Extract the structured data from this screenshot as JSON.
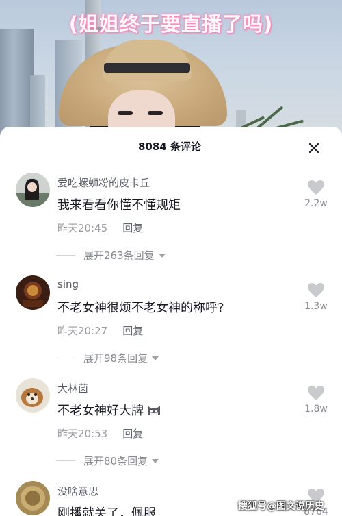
{
  "video": {
    "subtitle": "(姐姐终于要直播了吗)"
  },
  "sheet": {
    "title": "8084 条评论"
  },
  "comments": [
    {
      "user": "爱吃螺蛳粉的皮卡丘",
      "text": "我来看看你懂不懂规矩",
      "time": "昨天20:45",
      "reply": "回复",
      "expand": "展开263条回复",
      "likes": "2.2w"
    },
    {
      "user": "sing",
      "text": "不老女神很烦不老女神的称呼?",
      "time": "昨天20:27",
      "reply": "回复",
      "expand": "展开98条回复",
      "likes": "1.3w"
    },
    {
      "user": "大林菌",
      "text": "不老女神好大牌",
      "emoji": "cat-emoji",
      "time": "昨天20:53",
      "reply": "回复",
      "expand": "展开80条回复",
      "likes": "1.8w"
    },
    {
      "user": "没啥意思",
      "text": "刚播就关了，佩服",
      "likes": "8764"
    }
  ],
  "watermark": "搜狐号@图文说历史",
  "colors": {
    "subtitle_glow": "#ff8fc0",
    "text": "#1a1b22",
    "muted": "#9a9ba1"
  }
}
